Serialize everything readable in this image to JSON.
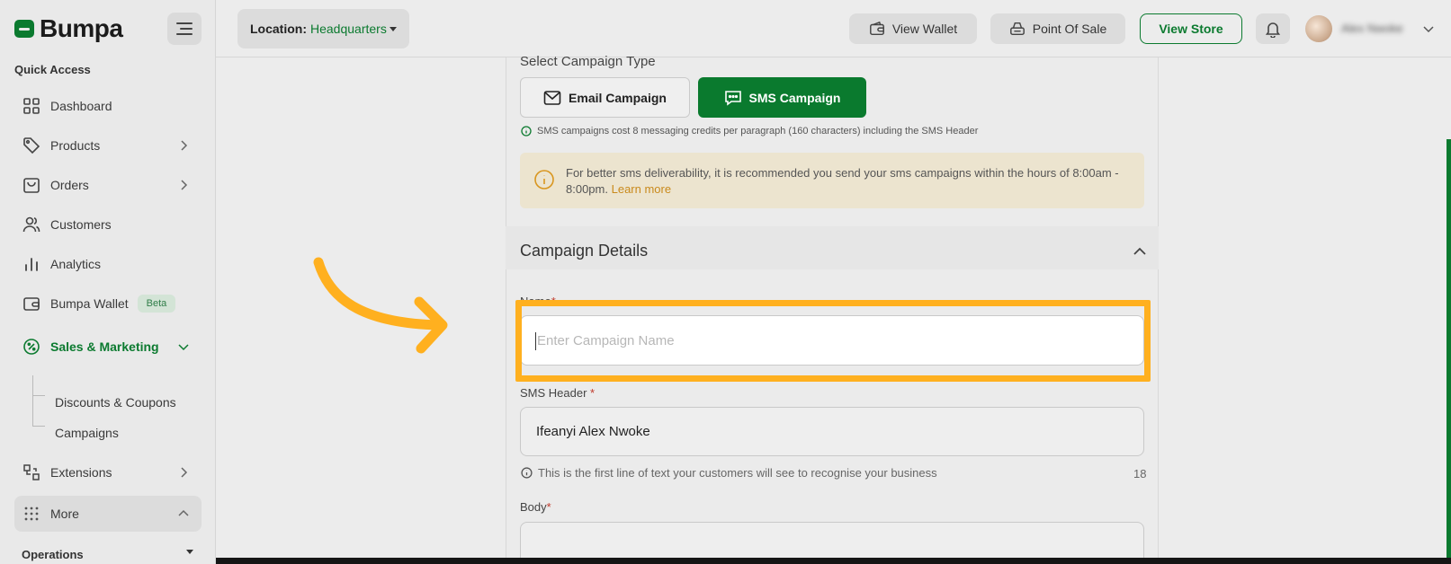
{
  "brand": {
    "name": "Bumpa",
    "color": "#0b7a2f"
  },
  "sidebar": {
    "quick_access_title": "Quick Access",
    "items": [
      {
        "label": "Dashboard",
        "icon": "grid-icon"
      },
      {
        "label": "Products",
        "icon": "tag-icon"
      },
      {
        "label": "Orders",
        "icon": "bag-icon"
      },
      {
        "label": "Customers",
        "icon": "users-icon"
      },
      {
        "label": "Analytics",
        "icon": "bar-chart-icon"
      },
      {
        "label": "Bumpa Wallet",
        "icon": "wallet-icon",
        "badge": "Beta"
      },
      {
        "label": "Sales & Marketing",
        "icon": "percent-icon",
        "active": true
      },
      {
        "label": "Extensions",
        "icon": "extensions-icon"
      },
      {
        "label": "More",
        "icon": "dots-grid-icon"
      }
    ],
    "sub_items": [
      {
        "label": "Discounts & Coupons"
      },
      {
        "label": "Campaigns"
      }
    ],
    "operations_title": "Operations"
  },
  "topbar": {
    "location_label": "Location:",
    "location_value": "Headquarters",
    "view_wallet": "View Wallet",
    "point_of_sale": "Point Of Sale",
    "view_store": "View Store",
    "user_name": "Alex Nwoke"
  },
  "campaign": {
    "select_type_title": "Select Campaign Type",
    "email_label": "Email Campaign",
    "sms_label": "SMS Campaign",
    "sms_cost_info": "SMS campaigns cost 8 messaging credits per paragraph (160 characters) including the SMS Header",
    "notice_text": "For better sms deliverability, it is recommended you send your sms campaigns within the hours of 8:00am - 8:00pm.",
    "notice_link": "Learn more",
    "details_title": "Campaign Details",
    "name_label": "Name",
    "name_placeholder": "Enter Campaign Name",
    "name_value": "",
    "sms_header_label": "SMS Header",
    "sms_header_value": "Ifeanyi Alex Nwoke",
    "sms_header_hint": "This is the first line of text your customers will see to recognise your business",
    "sms_header_count": "18",
    "body_label": "Body",
    "required_mark": "*"
  },
  "colors": {
    "accent": "#0b7a2f",
    "highlight": "#ffb01f",
    "notice_bg": "#ece4cf",
    "link": "#c98a1c"
  }
}
